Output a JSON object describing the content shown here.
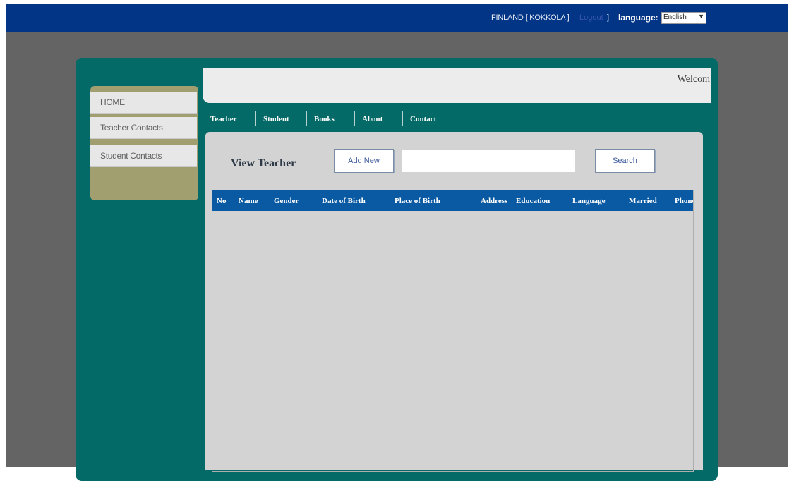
{
  "topbar": {
    "location": "FINLAND [ KOKKOLA ]",
    "link_text": "Logout",
    "separator": "]",
    "language_label": "language:",
    "language_selected": "English"
  },
  "header": {
    "welcome": "Welcom"
  },
  "sidebar": {
    "items": [
      {
        "label": "HOME"
      },
      {
        "label": "Teacher Contacts"
      },
      {
        "label": "Student Contacts"
      }
    ]
  },
  "tabs": [
    {
      "label": "Teacher"
    },
    {
      "label": "Student"
    },
    {
      "label": "Books"
    },
    {
      "label": "About"
    },
    {
      "label": "Contact"
    }
  ],
  "main": {
    "title": "View Teacher",
    "add_button": "Add New",
    "search_value": "",
    "search_button": "Search"
  },
  "table": {
    "columns": [
      "No",
      "Name",
      "Gender",
      "Date of Birth",
      "Place of Birth",
      "Address",
      "Education",
      "Language",
      "Married",
      "Phone"
    ],
    "rows": []
  },
  "colors": {
    "topbar": "#023585",
    "frame": "#046a67",
    "sidebar": "#a19e70",
    "table_header": "#0a5aa3",
    "page_background": "#646464"
  }
}
